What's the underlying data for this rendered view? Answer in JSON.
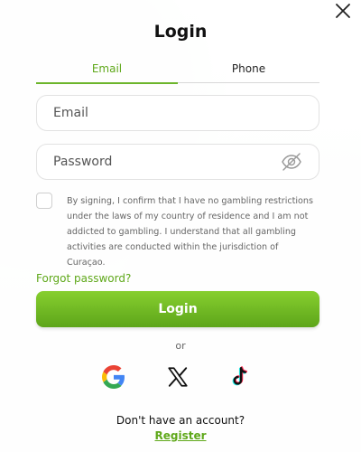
{
  "title": "Login",
  "tabs": [
    {
      "label": "Email",
      "active": true
    },
    {
      "label": "Phone",
      "active": false
    }
  ],
  "email": {
    "placeholder": "Email",
    "value": ""
  },
  "password": {
    "placeholder": "Password",
    "value": ""
  },
  "terms": {
    "checked": false,
    "text": "By signing, I confirm that I have no gambling restrictions under the laws of my country of residence and I am not addicted to gambling. I understand that all gambling activities are conducted within the jurisdiction of Curaçao."
  },
  "forgot_password": "Forgot password?",
  "login_button": "Login",
  "or_label": "or",
  "social": [
    "google-icon",
    "x-icon",
    "tiktok-icon"
  ],
  "signup_prompt": "Don't have an account?",
  "register_link": "Register",
  "colors": {
    "accent": "#5fa81a",
    "button_top": "#87cf2f",
    "button_bottom": "#5da51a"
  }
}
